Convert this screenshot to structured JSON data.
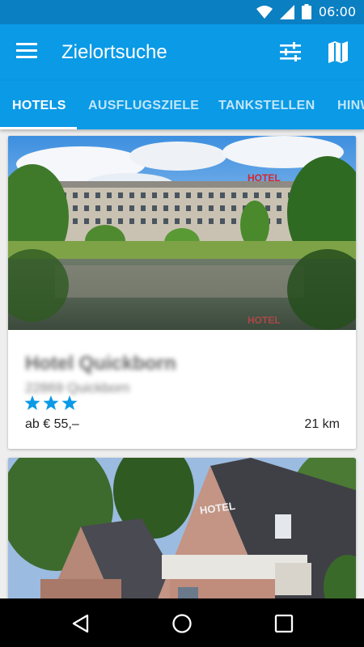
{
  "status_bar": {
    "time": "06:00",
    "icons": [
      "wifi-icon",
      "signal-icon",
      "battery-icon"
    ]
  },
  "app_bar": {
    "title": "Zielortsuche",
    "icons": [
      "menu-icon",
      "filter-icon",
      "map-icon"
    ]
  },
  "tabs": [
    {
      "label": "HOTELS",
      "selected": true
    },
    {
      "label": "AUSFLUGSZIELE",
      "selected": false
    },
    {
      "label": "TANKSTELLEN",
      "selected": false
    },
    {
      "label": "HINW",
      "selected": false
    }
  ],
  "cards": [
    {
      "name": "Hotel Quickborn",
      "city": "22869 Quickborn",
      "stars": 3,
      "price": "ab € 55,–",
      "distance": "21 km",
      "image": "hotel-lake-photo"
    },
    {
      "image": "hotel-brick-house-photo"
    }
  ],
  "nav_bar": {
    "icons": [
      "back-icon",
      "home-icon",
      "recents-icon"
    ]
  },
  "colors": {
    "status_bar": "#0a7fc2",
    "app_bar": "#0a9ae6",
    "star": "#0a9ae6",
    "background": "#eeeeee"
  }
}
